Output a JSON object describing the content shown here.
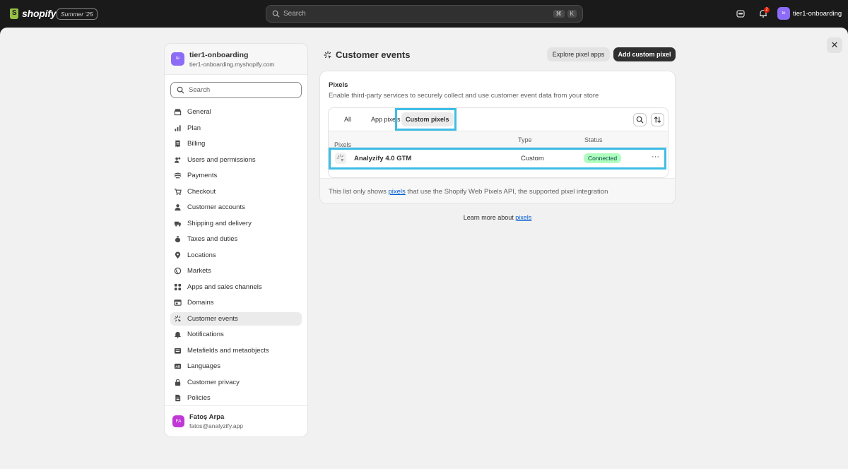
{
  "topbar": {
    "brand": "shopify",
    "edition": "Summer '25",
    "search_placeholder": "Search",
    "shortcut_key1": "⌘",
    "shortcut_key2": "K",
    "notification_count": "2",
    "store_initials": "te",
    "store_name": "tier1-onboarding"
  },
  "nav": {
    "store_initials": "te",
    "store_name": "tier1-onboarding",
    "store_domain": "tier1-onboarding.myshopify.com",
    "search_placeholder": "Search",
    "items": [
      {
        "label": "General",
        "icon": "store-icon"
      },
      {
        "label": "Plan",
        "icon": "chart-icon"
      },
      {
        "label": "Billing",
        "icon": "receipt-icon"
      },
      {
        "label": "Users and permissions",
        "icon": "users-icon"
      },
      {
        "label": "Payments",
        "icon": "payment-icon"
      },
      {
        "label": "Checkout",
        "icon": "cart-icon"
      },
      {
        "label": "Customer accounts",
        "icon": "person-icon"
      },
      {
        "label": "Shipping and delivery",
        "icon": "truck-icon"
      },
      {
        "label": "Taxes and duties",
        "icon": "money-bag-icon"
      },
      {
        "label": "Locations",
        "icon": "location-icon"
      },
      {
        "label": "Markets",
        "icon": "globe-icon"
      },
      {
        "label": "Apps and sales channels",
        "icon": "apps-icon"
      },
      {
        "label": "Domains",
        "icon": "domain-icon"
      },
      {
        "label": "Customer events",
        "icon": "sparkle-icon",
        "active": true
      },
      {
        "label": "Notifications",
        "icon": "bell-icon"
      },
      {
        "label": "Metafields and metaobjects",
        "icon": "database-icon"
      },
      {
        "label": "Languages",
        "icon": "language-icon"
      },
      {
        "label": "Customer privacy",
        "icon": "lock-icon"
      },
      {
        "label": "Policies",
        "icon": "document-icon"
      }
    ],
    "user": {
      "initials": "FA",
      "name": "Fatoş Arpa",
      "email": "fatos@analyzify.app"
    }
  },
  "main": {
    "title": "Customer events",
    "explore_button": "Explore pixel apps",
    "add_button": "Add custom pixel",
    "card": {
      "title": "Pixels",
      "subtitle": "Enable third-party services to securely collect and use customer event data from your store",
      "tabs": [
        "All",
        "App pixels",
        "Custom pixels"
      ],
      "selected_tab": "Custom pixels",
      "columns": [
        "Pixels",
        "Type",
        "Status"
      ],
      "rows": [
        {
          "name": "Analyzify 4.0 GTM",
          "type": "Custom",
          "status": "Connected",
          "more": "···"
        }
      ],
      "footer_pre": "This list only shows ",
      "footer_link": "pixels",
      "footer_post": " that use the Shopify Web Pixels API, the supported pixel integration"
    },
    "learn_pre": "Learn more about ",
    "learn_link": "pixels"
  },
  "colors": {
    "accent_highlight": "#3dbde6",
    "status_connected_bg": "#affebf",
    "primary_button": "#303030",
    "store_avatar": "#8c6cf6",
    "user_avatar": "#c038d6"
  }
}
